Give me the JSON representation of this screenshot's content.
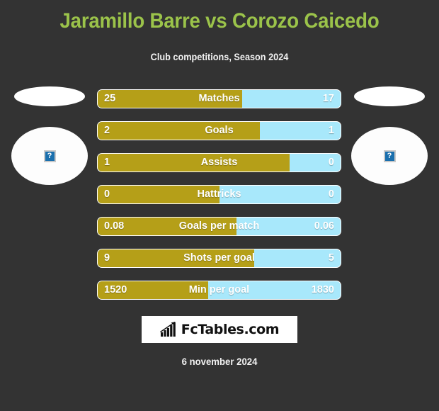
{
  "header": {
    "title": "Jaramillo Barre vs Corozo Caicedo",
    "subtitle": "Club competitions, Season 2024"
  },
  "colors": {
    "background": "#333333",
    "title_green": "#9bc34a",
    "home_gold": "#b59f18",
    "away_blue": "#a8e8fb",
    "bar_border": "#ffffff",
    "logo_bg": "#ffffff",
    "placeholder_blue": "#1a6fad"
  },
  "players": {
    "left": {
      "flag_icon": "flag-ellipse-placeholder",
      "photo_icon": "broken-image-icon",
      "photo_glyph": "?"
    },
    "right": {
      "flag_icon": "flag-ellipse-placeholder",
      "photo_icon": "broken-image-icon",
      "photo_glyph": "?"
    }
  },
  "chart_data": {
    "type": "bar",
    "title": "Jaramillo Barre vs Corozo Caicedo",
    "subtitle": "Club competitions, Season 2024",
    "orientation": "horizontal-diverging",
    "legend": [
      "Jaramillo Barre",
      "Corozo Caicedo"
    ],
    "categories": [
      "Matches",
      "Goals",
      "Assists",
      "Hattricks",
      "Goals per match",
      "Shots per goal",
      "Min per goal"
    ],
    "series": [
      {
        "name": "Jaramillo Barre",
        "color": "#b59f18",
        "values": [
          25,
          2,
          1,
          0,
          0.08,
          9,
          1520
        ]
      },
      {
        "name": "Corozo Caicedo",
        "color": "#a8e8fb",
        "values": [
          17,
          1,
          0,
          0,
          0.06,
          5,
          1830
        ]
      }
    ],
    "rows": [
      {
        "label": "Matches",
        "home": "25",
        "away": "17",
        "home_pct": 59.5
      },
      {
        "label": "Goals",
        "home": "2",
        "away": "1",
        "home_pct": 66.7
      },
      {
        "label": "Assists",
        "home": "1",
        "away": "0",
        "home_pct": 79.0
      },
      {
        "label": "Hattricks",
        "home": "0",
        "away": "0",
        "home_pct": 50.0
      },
      {
        "label": "Goals per match",
        "home": "0.08",
        "away": "0.06",
        "home_pct": 57.1
      },
      {
        "label": "Shots per goal",
        "home": "9",
        "away": "5",
        "home_pct": 64.3
      },
      {
        "label": "Min per goal",
        "home": "1520",
        "away": "1830",
        "home_pct": 45.4
      }
    ]
  },
  "footer": {
    "logo_icon": "bar-chart-growth-icon",
    "logo_text": "FcTables.com",
    "date": "6 november 2024"
  }
}
